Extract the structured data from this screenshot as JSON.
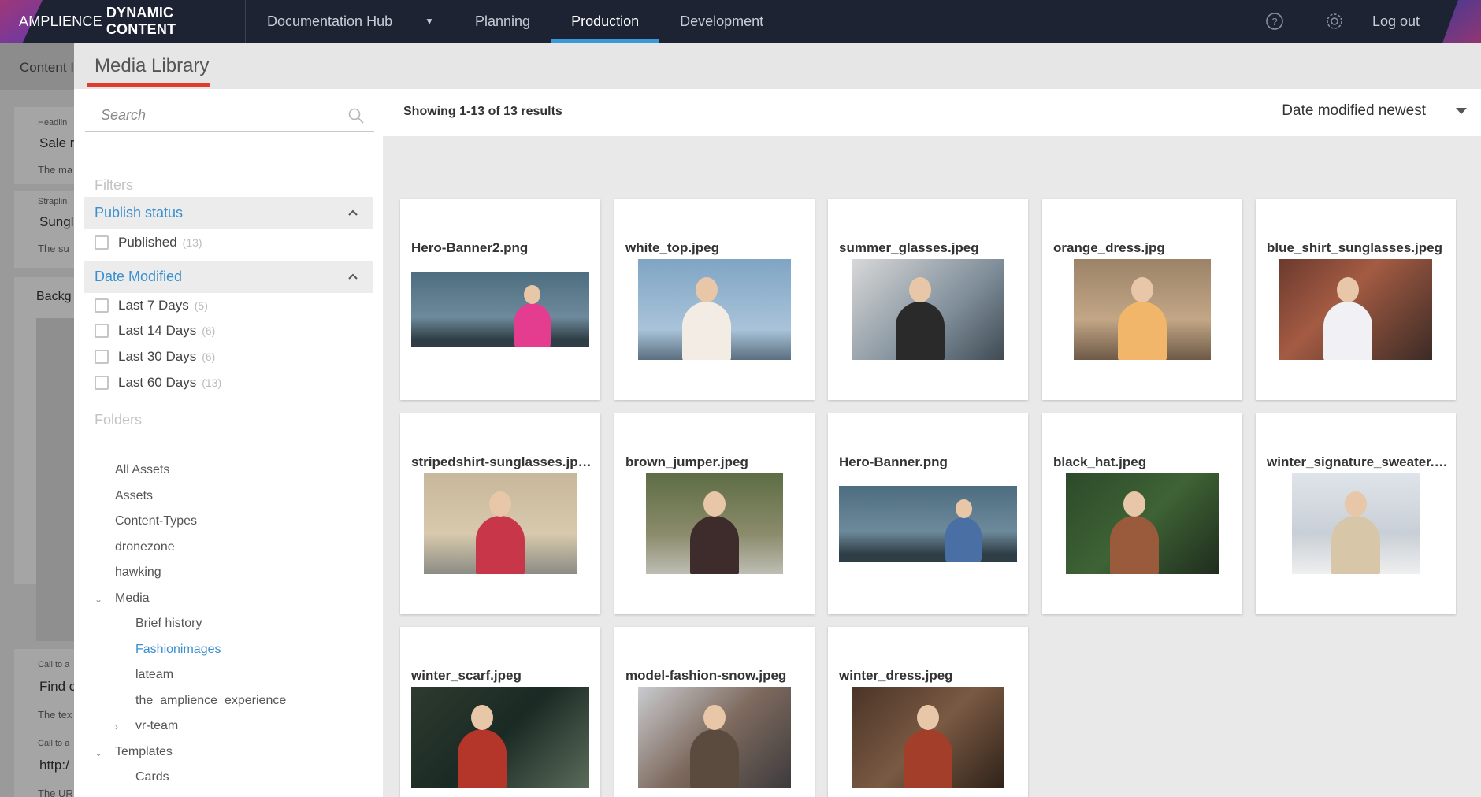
{
  "topbar": {
    "brand_light": "AMPLIENCE",
    "brand_bold": "DYNAMIC CONTENT",
    "hub": "Documentation Hub",
    "tabs": [
      {
        "label": "Planning",
        "active": false
      },
      {
        "label": "Production",
        "active": true
      },
      {
        "label": "Development",
        "active": false
      }
    ],
    "logout": "Log out",
    "icons": [
      "help-icon",
      "gear-icon"
    ]
  },
  "background_editor": {
    "title": "Content I",
    "fields": [
      {
        "label": "Headlin",
        "value": "Sale r",
        "help": "The ma"
      },
      {
        "label": "Straplin",
        "value": "Sungl",
        "help": "The su"
      },
      {
        "label": "Backg",
        "value": "",
        "help": ""
      },
      {
        "label": "Call to a",
        "value": "Find c",
        "help": "The tex"
      },
      {
        "label": "Call to a",
        "value": "http:/",
        "help": "The UR"
      }
    ]
  },
  "modal": {
    "title": "Media Library",
    "search": {
      "placeholder": "Search",
      "value": ""
    },
    "filters_label": "Filters",
    "publish_status": {
      "title": "Publish status",
      "options": [
        {
          "label": "Published",
          "count": "(13)"
        }
      ]
    },
    "date_modified": {
      "title": "Date Modified",
      "options": [
        {
          "label": "Last 7 Days",
          "count": "(5)"
        },
        {
          "label": "Last 14 Days",
          "count": "(6)"
        },
        {
          "label": "Last 30 Days",
          "count": "(6)"
        },
        {
          "label": "Last 60 Days",
          "count": "(13)"
        }
      ]
    },
    "folders_label": "Folders",
    "folders": [
      {
        "label": "All Assets",
        "level": 1,
        "toggle": ""
      },
      {
        "label": "Assets",
        "level": 1,
        "toggle": ""
      },
      {
        "label": "Content-Types",
        "level": 1,
        "toggle": ""
      },
      {
        "label": "dronezone",
        "level": 1,
        "toggle": ""
      },
      {
        "label": "hawking",
        "level": 1,
        "toggle": ""
      },
      {
        "label": "Media",
        "level": 1,
        "toggle": "expanded"
      },
      {
        "label": "Brief history",
        "level": 2,
        "toggle": ""
      },
      {
        "label": "Fashionimages",
        "level": 2,
        "toggle": "",
        "active": true
      },
      {
        "label": "lateam",
        "level": 2,
        "toggle": ""
      },
      {
        "label": "the_amplience_experience",
        "level": 2,
        "toggle": ""
      },
      {
        "label": "vr-team",
        "level": 2,
        "toggle": "collapsed"
      },
      {
        "label": "Templates",
        "level": 1,
        "toggle": "expanded"
      },
      {
        "label": "Cards",
        "level": 2,
        "toggle": ""
      }
    ],
    "results_text": "Showing 1-13 of 13 results",
    "sort": "Date modified newest",
    "assets": [
      "Hero-Banner2.png",
      "white_top.jpeg",
      "summer_glasses.jpeg",
      "orange_dress.jpg",
      "blue_shirt_sunglasses.jpeg",
      "stripedshirt-sunglasses.jpeg",
      "brown_jumper.jpeg",
      "Hero-Banner.png",
      "black_hat.jpeg",
      "winter_signature_sweater.jpeg",
      "winter_scarf.jpeg",
      "model-fashion-snow.jpeg",
      "winter_dress.jpeg"
    ]
  },
  "colors": {
    "nav_bg": "#1d2332",
    "accent_blue": "#3a8fcf",
    "tab_underline": "#3a9ad9",
    "title_underline": "#e03c2e"
  }
}
